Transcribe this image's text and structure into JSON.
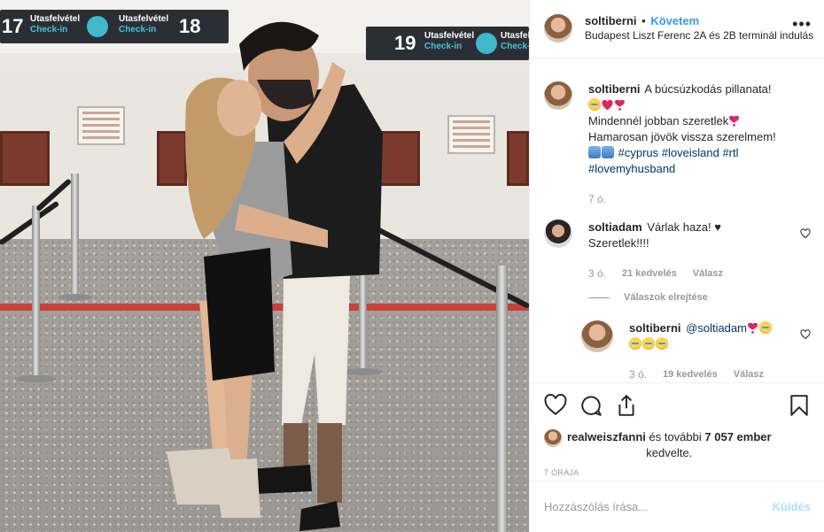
{
  "photo": {
    "signs": [
      {
        "number_left": "17",
        "title": "Utasfelvétel",
        "subtitle": "Check-in",
        "title2": "Utasfelvétel",
        "subtitle2": "Check-in",
        "number_right": "18"
      },
      {
        "number_left": "19",
        "title": "Utasfelvétel",
        "subtitle": "Check-in",
        "title2": "Utasfelvétel",
        "subtitle2": "Check-in"
      }
    ]
  },
  "header": {
    "username": "soltiberni",
    "separator": "•",
    "follow_label": "Követem",
    "location": "Budapest Liszt Ferenc 2A és 2B terminál indulás",
    "more_icon": "more-options-icon"
  },
  "caption": {
    "username": "soltiberni",
    "line1": "A búcsúzkodás pillanata!",
    "line2": "Mindennél jobban szeretlek",
    "line3": "Hamarosan jövök vissza szerelmem!",
    "hashtags_line": [
      "#cyprus",
      "#loveisland",
      "#rtl"
    ],
    "hashtag_last": "#lovemyhusband",
    "time": "7 ó."
  },
  "comments": [
    {
      "username": "soltiadam",
      "text1": "Várlak haza!",
      "text2": "Szeretlek!!!!",
      "time": "3 ó.",
      "likes": "21 kedvelés",
      "reply_label": "Válasz",
      "hide_replies_label": "Válaszok elrejtése"
    }
  ],
  "reply": {
    "username": "soltiberni",
    "mention": "@soltiadam",
    "time": "3 ó.",
    "likes": "19 kedvelés",
    "reply_label": "Válasz"
  },
  "likes": {
    "liker": "realweiszfanni",
    "middle": "és további",
    "count": "7 057 ember",
    "suffix": "kedvelte."
  },
  "timestamp": "7 ÓRÁJA",
  "add_comment": {
    "placeholder": "Hozzászólás írása...",
    "post_label": "Küldés"
  },
  "colors": {
    "link_blue": "#3897f0",
    "hashtag": "#003569",
    "muted": "#999999",
    "post_disabled": "#b2dffc",
    "heart_red": "#e0245e"
  }
}
